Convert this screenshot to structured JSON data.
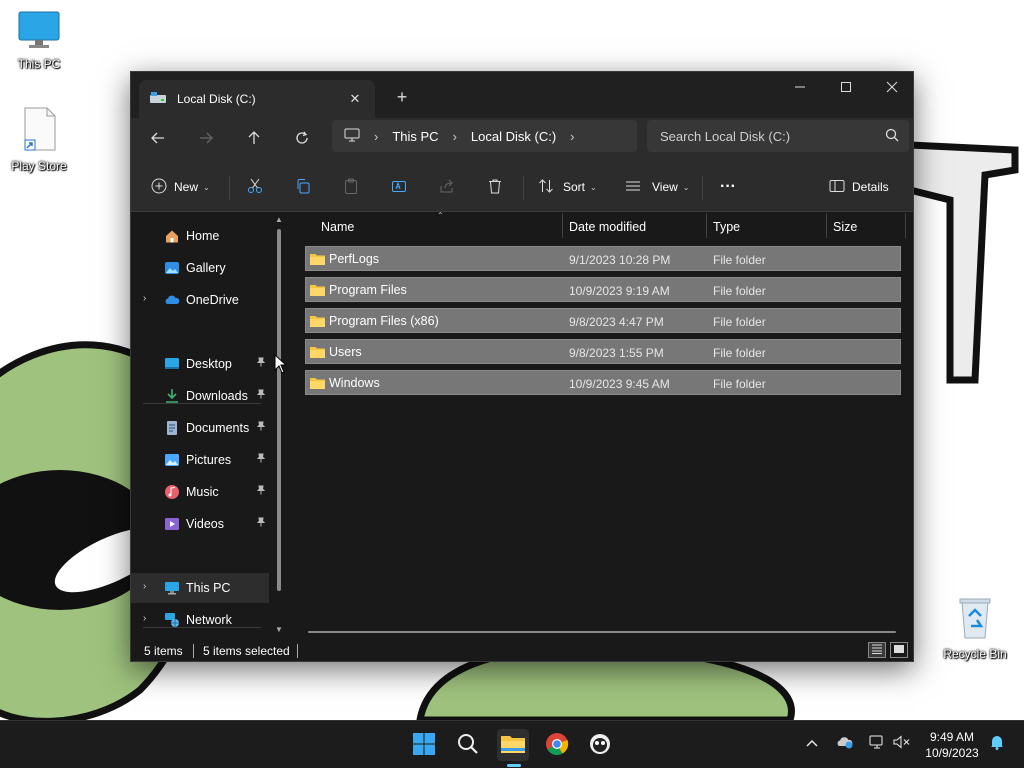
{
  "desktop": {
    "icons": [
      {
        "label": "This PC",
        "icon": "monitor-icon"
      },
      {
        "label": "Play Store",
        "icon": "shortcut-file-icon"
      },
      {
        "label": "Recycle Bin",
        "icon": "recycle-bin-icon"
      }
    ]
  },
  "window": {
    "tab_title": "Local Disk (C:)",
    "tab_close": "✕",
    "new_tab": "+",
    "controls": {
      "minimize": "—",
      "maximize": "☐",
      "close": "✕"
    },
    "address": {
      "root_icon": "monitor-icon",
      "separator": "›",
      "crumbs": [
        "This PC",
        "Local Disk (C:)"
      ]
    },
    "search_placeholder": "Search Local Disk (C:)",
    "toolbar": {
      "new_label": "New",
      "sort_label": "Sort",
      "view_label": "View",
      "more_label": "···",
      "details_label": "Details",
      "caret": "⌄"
    },
    "nav": {
      "items_top": [
        {
          "label": "Home",
          "icon": "home-icon"
        },
        {
          "label": "Gallery",
          "icon": "gallery-icon"
        },
        {
          "label": "OneDrive",
          "icon": "cloud-icon"
        }
      ],
      "items_quick": [
        {
          "label": "Desktop",
          "icon": "desktop-folder-icon"
        },
        {
          "label": "Downloads",
          "icon": "download-icon"
        },
        {
          "label": "Documents",
          "icon": "document-icon"
        },
        {
          "label": "Pictures",
          "icon": "pictures-icon"
        },
        {
          "label": "Music",
          "icon": "music-icon"
        },
        {
          "label": "Videos",
          "icon": "video-icon"
        }
      ],
      "items_bottom": [
        {
          "label": "This PC",
          "icon": "monitor-icon"
        },
        {
          "label": "Network",
          "icon": "network-icon"
        }
      ],
      "chevron": "›",
      "pin": "📌"
    },
    "columns": [
      "Name",
      "Date modified",
      "Type",
      "Size"
    ],
    "files": [
      {
        "name": "PerfLogs",
        "date": "9/1/2023 10:28 PM",
        "type": "File folder"
      },
      {
        "name": "Program Files",
        "date": "10/9/2023 9:19 AM",
        "type": "File folder"
      },
      {
        "name": "Program Files (x86)",
        "date": "9/8/2023 4:47 PM",
        "type": "File folder"
      },
      {
        "name": "Users",
        "date": "9/8/2023 1:55 PM",
        "type": "File folder"
      },
      {
        "name": "Windows",
        "date": "10/9/2023 9:45 AM",
        "type": "File folder"
      }
    ],
    "status": {
      "count": "5 items",
      "selected": "5 items selected"
    }
  },
  "taskbar": {
    "apps": [
      "start-icon",
      "search-icon",
      "file-explorer-icon",
      "chrome-icon",
      "app-icon"
    ],
    "tray": [
      "chevron-up-icon",
      "onedrive-icon",
      "network-icon",
      "volume-muted-icon"
    ],
    "time": "9:49 AM",
    "date": "10/9/2023"
  },
  "colors": {
    "accent": "#60cdff",
    "folder": "#f5c542",
    "row_selected": "#777777"
  }
}
